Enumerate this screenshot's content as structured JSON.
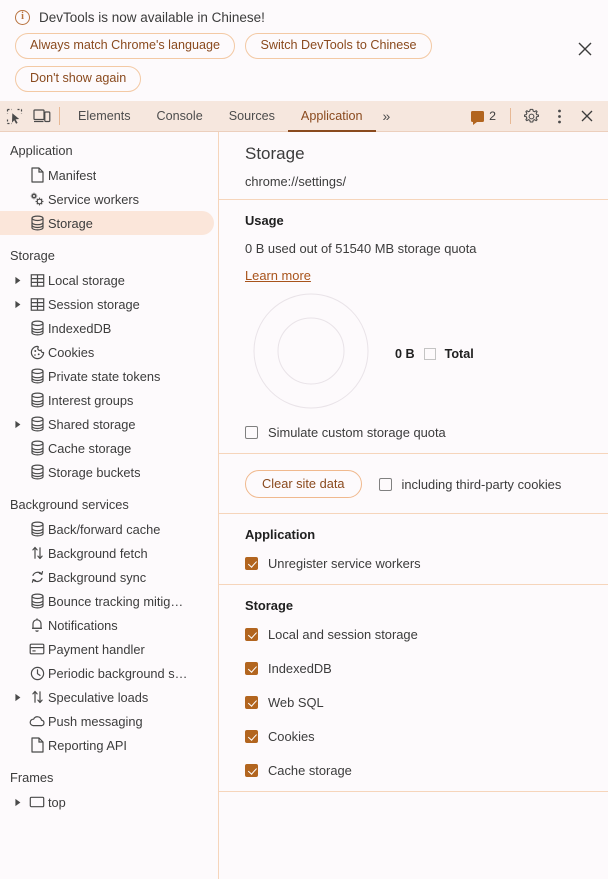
{
  "banner": {
    "icon": "info-icon",
    "message": "DevTools is now available in Chinese!",
    "buttons": [
      {
        "label": "Always match Chrome's language",
        "name": "always-match-language-button"
      },
      {
        "label": "Switch DevTools to Chinese",
        "name": "switch-devtools-language-button"
      },
      {
        "label": "Don't show again",
        "name": "dont-show-again-button"
      }
    ],
    "close_label": "×"
  },
  "tabstrip": {
    "inspect_icon": "inspect-element-icon",
    "device_icon": "device-toolbar-icon",
    "tabs": [
      {
        "label": "Elements",
        "active": false
      },
      {
        "label": "Console",
        "active": false
      },
      {
        "label": "Sources",
        "active": false
      },
      {
        "label": "Application",
        "active": true
      }
    ],
    "more_tabs_label": "»",
    "issues_count": "2",
    "settings_icon": "gear-icon",
    "more_options_icon": "kebab-menu-icon",
    "close_icon": "close-icon"
  },
  "sidebar": {
    "groups": [
      {
        "title": "Application",
        "items": [
          {
            "label": "Manifest",
            "icon": "document-icon",
            "arrow": false,
            "selected": false
          },
          {
            "label": "Service workers",
            "icon": "gears-icon",
            "arrow": false,
            "selected": false
          },
          {
            "label": "Storage",
            "icon": "database-icon",
            "arrow": false,
            "selected": true
          }
        ]
      },
      {
        "title": "Storage",
        "items": [
          {
            "label": "Local storage",
            "icon": "table-icon",
            "arrow": true,
            "selected": false
          },
          {
            "label": "Session storage",
            "icon": "table-icon",
            "arrow": true,
            "selected": false
          },
          {
            "label": "IndexedDB",
            "icon": "database-icon",
            "arrow": false,
            "selected": false
          },
          {
            "label": "Cookies",
            "icon": "cookie-icon",
            "arrow": false,
            "selected": false
          },
          {
            "label": "Private state tokens",
            "icon": "database-icon",
            "arrow": false,
            "selected": false
          },
          {
            "label": "Interest groups",
            "icon": "database-icon",
            "arrow": false,
            "selected": false
          },
          {
            "label": "Shared storage",
            "icon": "database-icon",
            "arrow": true,
            "selected": false
          },
          {
            "label": "Cache storage",
            "icon": "database-icon",
            "arrow": false,
            "selected": false
          },
          {
            "label": "Storage buckets",
            "icon": "database-icon",
            "arrow": false,
            "selected": false
          }
        ]
      },
      {
        "title": "Background services",
        "items": [
          {
            "label": "Back/forward cache",
            "icon": "database-icon",
            "arrow": false,
            "selected": false
          },
          {
            "label": "Background fetch",
            "icon": "updown-arrows-icon",
            "arrow": false,
            "selected": false
          },
          {
            "label": "Background sync",
            "icon": "sync-icon",
            "arrow": false,
            "selected": false
          },
          {
            "label": "Bounce tracking mitig…",
            "icon": "database-icon",
            "arrow": false,
            "selected": false
          },
          {
            "label": "Notifications",
            "icon": "bell-icon",
            "arrow": false,
            "selected": false
          },
          {
            "label": "Payment handler",
            "icon": "credit-card-icon",
            "arrow": false,
            "selected": false
          },
          {
            "label": "Periodic background s…",
            "icon": "clock-icon",
            "arrow": false,
            "selected": false
          },
          {
            "label": "Speculative loads",
            "icon": "updown-arrows-icon",
            "arrow": true,
            "selected": false
          },
          {
            "label": "Push messaging",
            "icon": "cloud-icon",
            "arrow": false,
            "selected": false
          },
          {
            "label": "Reporting API",
            "icon": "document-icon",
            "arrow": false,
            "selected": false
          }
        ]
      },
      {
        "title": "Frames",
        "items": [
          {
            "label": "top",
            "icon": "frame-icon",
            "arrow": true,
            "selected": false
          }
        ]
      }
    ]
  },
  "content": {
    "title": "Storage",
    "origin": "chrome://settings/",
    "usage": {
      "heading": "Usage",
      "summary": "0 B used out of 51540 MB storage quota",
      "learn_more": "Learn more",
      "legend_value": "0 B",
      "legend_label": "Total",
      "simulate_quota_label": "Simulate custom storage quota",
      "simulate_quota_checked": false
    },
    "clear": {
      "button_label": "Clear site data",
      "third_party_label": "including third-party cookies",
      "third_party_checked": false
    },
    "application_section": {
      "heading": "Application",
      "items": [
        {
          "label": "Unregister service workers",
          "checked": true
        }
      ]
    },
    "storage_section": {
      "heading": "Storage",
      "items": [
        {
          "label": "Local and session storage",
          "checked": true
        },
        {
          "label": "IndexedDB",
          "checked": true
        },
        {
          "label": "Web SQL",
          "checked": true
        },
        {
          "label": "Cookies",
          "checked": true
        },
        {
          "label": "Cache storage",
          "checked": true
        }
      ]
    }
  },
  "colors": {
    "accent": "#8a4a1e",
    "checkbox_checked": "#b2651f",
    "tabstrip_bg": "#f6e7de",
    "selected_row": "#fbe6da",
    "divider": "#f6d5bb",
    "page_bg": "#fdfafc"
  }
}
